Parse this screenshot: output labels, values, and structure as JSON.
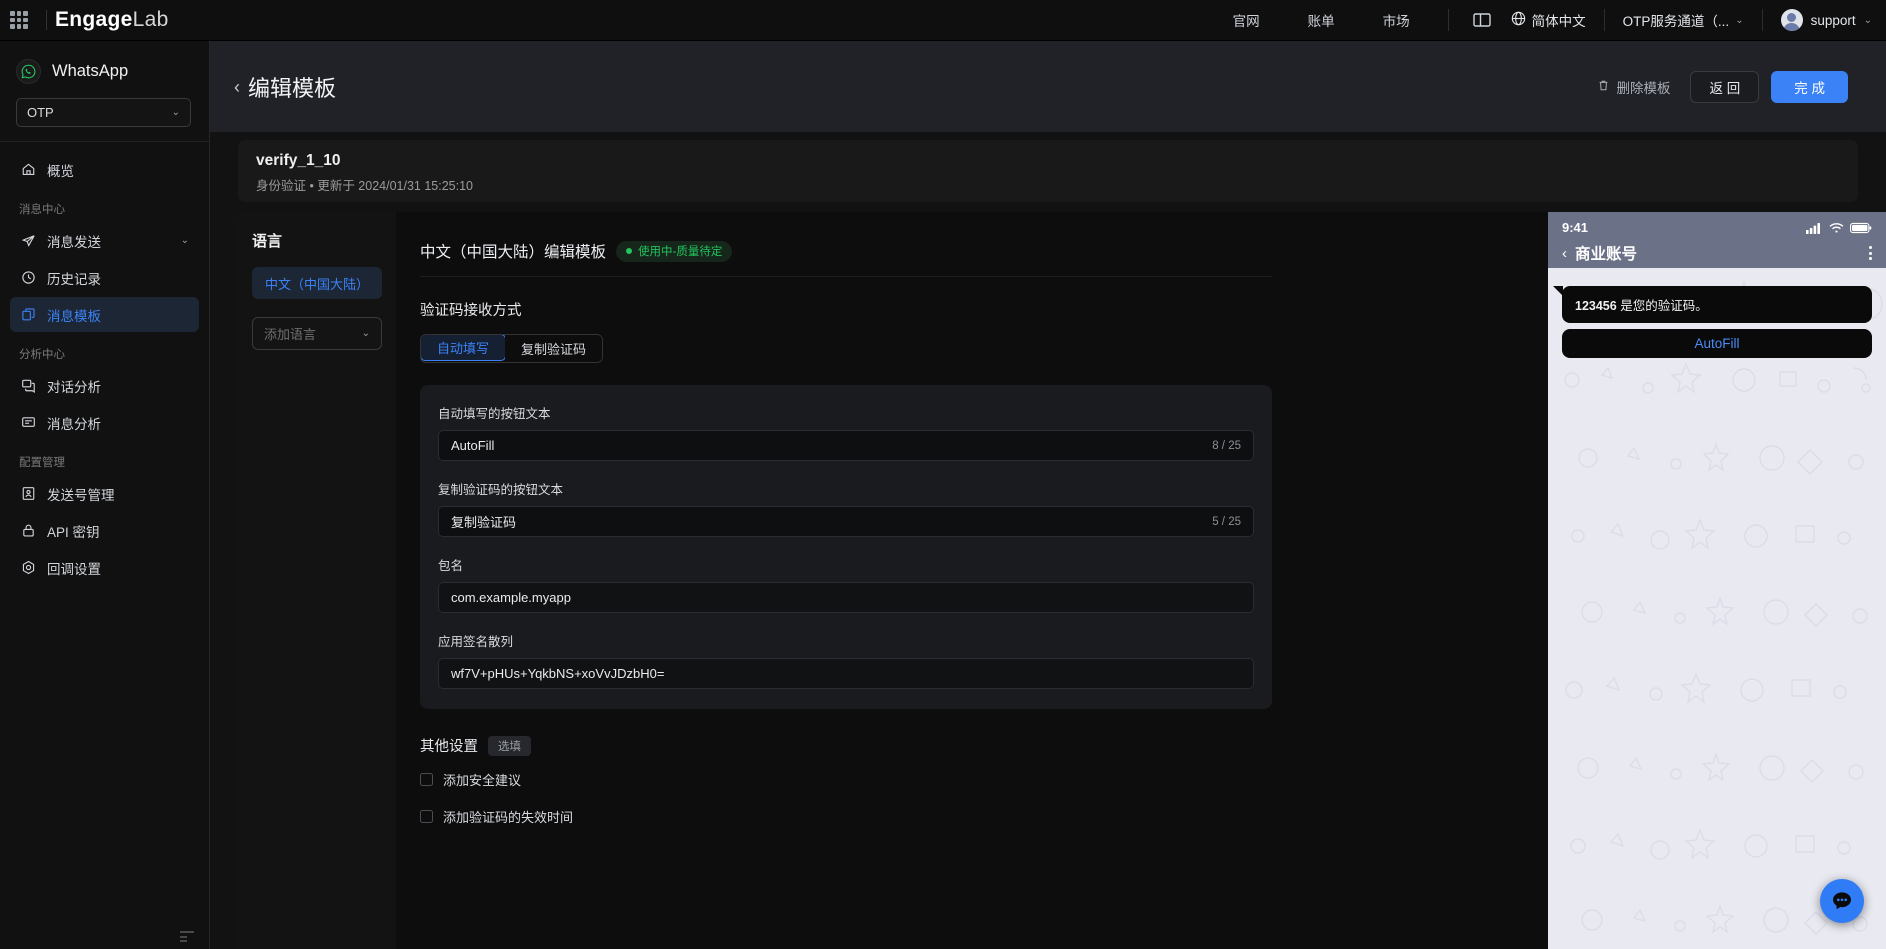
{
  "topbar": {
    "apps_icon": "grid-apps-icon",
    "brand_part1": "Engage",
    "brand_part2": "Lab",
    "links": [
      {
        "label": "官网",
        "name": "topnav-official-site"
      },
      {
        "label": "账单",
        "name": "topnav-billing"
      },
      {
        "label": "市场",
        "name": "topnav-market"
      }
    ],
    "panel_icon": "panel-layout-icon",
    "globe_icon": "globe-icon",
    "language": "简体中文",
    "channel": "OTP服务通道（...",
    "user": "support"
  },
  "sidebar": {
    "product": "WhatsApp",
    "product_icon": "whatsapp-icon",
    "channel_select": "OTP",
    "items": [
      {
        "label": "概览",
        "icon": "home-icon",
        "name": "sidebar-item-overview",
        "active": false,
        "expandable": false
      },
      {
        "label": "消息发送",
        "icon": "send-icon",
        "name": "sidebar-item-send-message",
        "active": false,
        "expandable": true
      },
      {
        "label": "历史记录",
        "icon": "history-icon",
        "name": "sidebar-item-history",
        "active": false,
        "expandable": false
      },
      {
        "label": "消息模板",
        "icon": "template-icon",
        "name": "sidebar-item-message-template",
        "active": true,
        "expandable": false
      },
      {
        "label": "对话分析",
        "icon": "conversation-analytics-icon",
        "name": "sidebar-item-conversation-analytics",
        "active": false,
        "expandable": false
      },
      {
        "label": "消息分析",
        "icon": "message-analytics-icon",
        "name": "sidebar-item-message-analytics",
        "active": false,
        "expandable": false
      },
      {
        "label": "发送号管理",
        "icon": "phone-number-icon",
        "name": "sidebar-item-sender-number",
        "active": false,
        "expandable": false
      },
      {
        "label": "API 密钥",
        "icon": "lock-icon",
        "name": "sidebar-item-api-key",
        "active": false,
        "expandable": false
      },
      {
        "label": "回调设置",
        "icon": "callback-icon",
        "name": "sidebar-item-callback-settings",
        "active": false,
        "expandable": false
      }
    ],
    "group_labels": {
      "message_center": "消息中心",
      "analytics_center": "分析中心",
      "config_management": "配置管理"
    }
  },
  "page_header": {
    "title": "编辑模板",
    "delete_label": "删除模板",
    "delete_icon": "trash-icon",
    "back_label": "返 回",
    "done_label": "完 成"
  },
  "info_card": {
    "template_name": "verify_1_10",
    "meta": "身份验证 • 更新于 2024/01/31 15:25:10"
  },
  "language_panel": {
    "heading": "语言",
    "active_language": "中文（中国大陆）",
    "add_language_placeholder": "添加语言"
  },
  "editor": {
    "title": "中文（中国大陆）编辑模板",
    "status": "使用中-质量待定",
    "section_label": "验证码接收方式",
    "tabs": [
      {
        "label": "自动填写",
        "name": "tab-autofill",
        "active": true
      },
      {
        "label": "复制验证码",
        "name": "tab-copy-code",
        "active": false
      }
    ],
    "fields": [
      {
        "label": "自动填写的按钮文本",
        "value": "AutoFill",
        "counter": "8 / 25",
        "name": "autofill-button-text"
      },
      {
        "label": "复制验证码的按钮文本",
        "value": "复制验证码",
        "counter": "5 / 25",
        "name": "copy-code-button-text"
      },
      {
        "label": "包名",
        "value": "com.example.myapp",
        "counter": "",
        "name": "package-name"
      },
      {
        "label": "应用签名散列",
        "value": "wf7V+pHUs+YqkbNS+xoVvJDzbH0=",
        "counter": "",
        "name": "app-signature-hash"
      }
    ],
    "other_settings_title": "其他设置",
    "other_settings_badge": "选填",
    "checkboxes": [
      {
        "label": "添加安全建议",
        "checked": false,
        "name": "checkbox-security-advice"
      },
      {
        "label": "添加验证码的失效时间",
        "checked": false,
        "name": "checkbox-code-expiry"
      }
    ]
  },
  "preview": {
    "status_time": "9:41",
    "contact_name": "商业账号",
    "message_code": "123456",
    "message_text": " 是您的验证码。",
    "action_button": "AutoFill"
  },
  "fab": {
    "icon": "chat-bubble-icon"
  },
  "colors": {
    "accent": "#3b82f6",
    "status_green": "#22c55e",
    "page_bg": "#121212",
    "header_bg": "#212227"
  }
}
